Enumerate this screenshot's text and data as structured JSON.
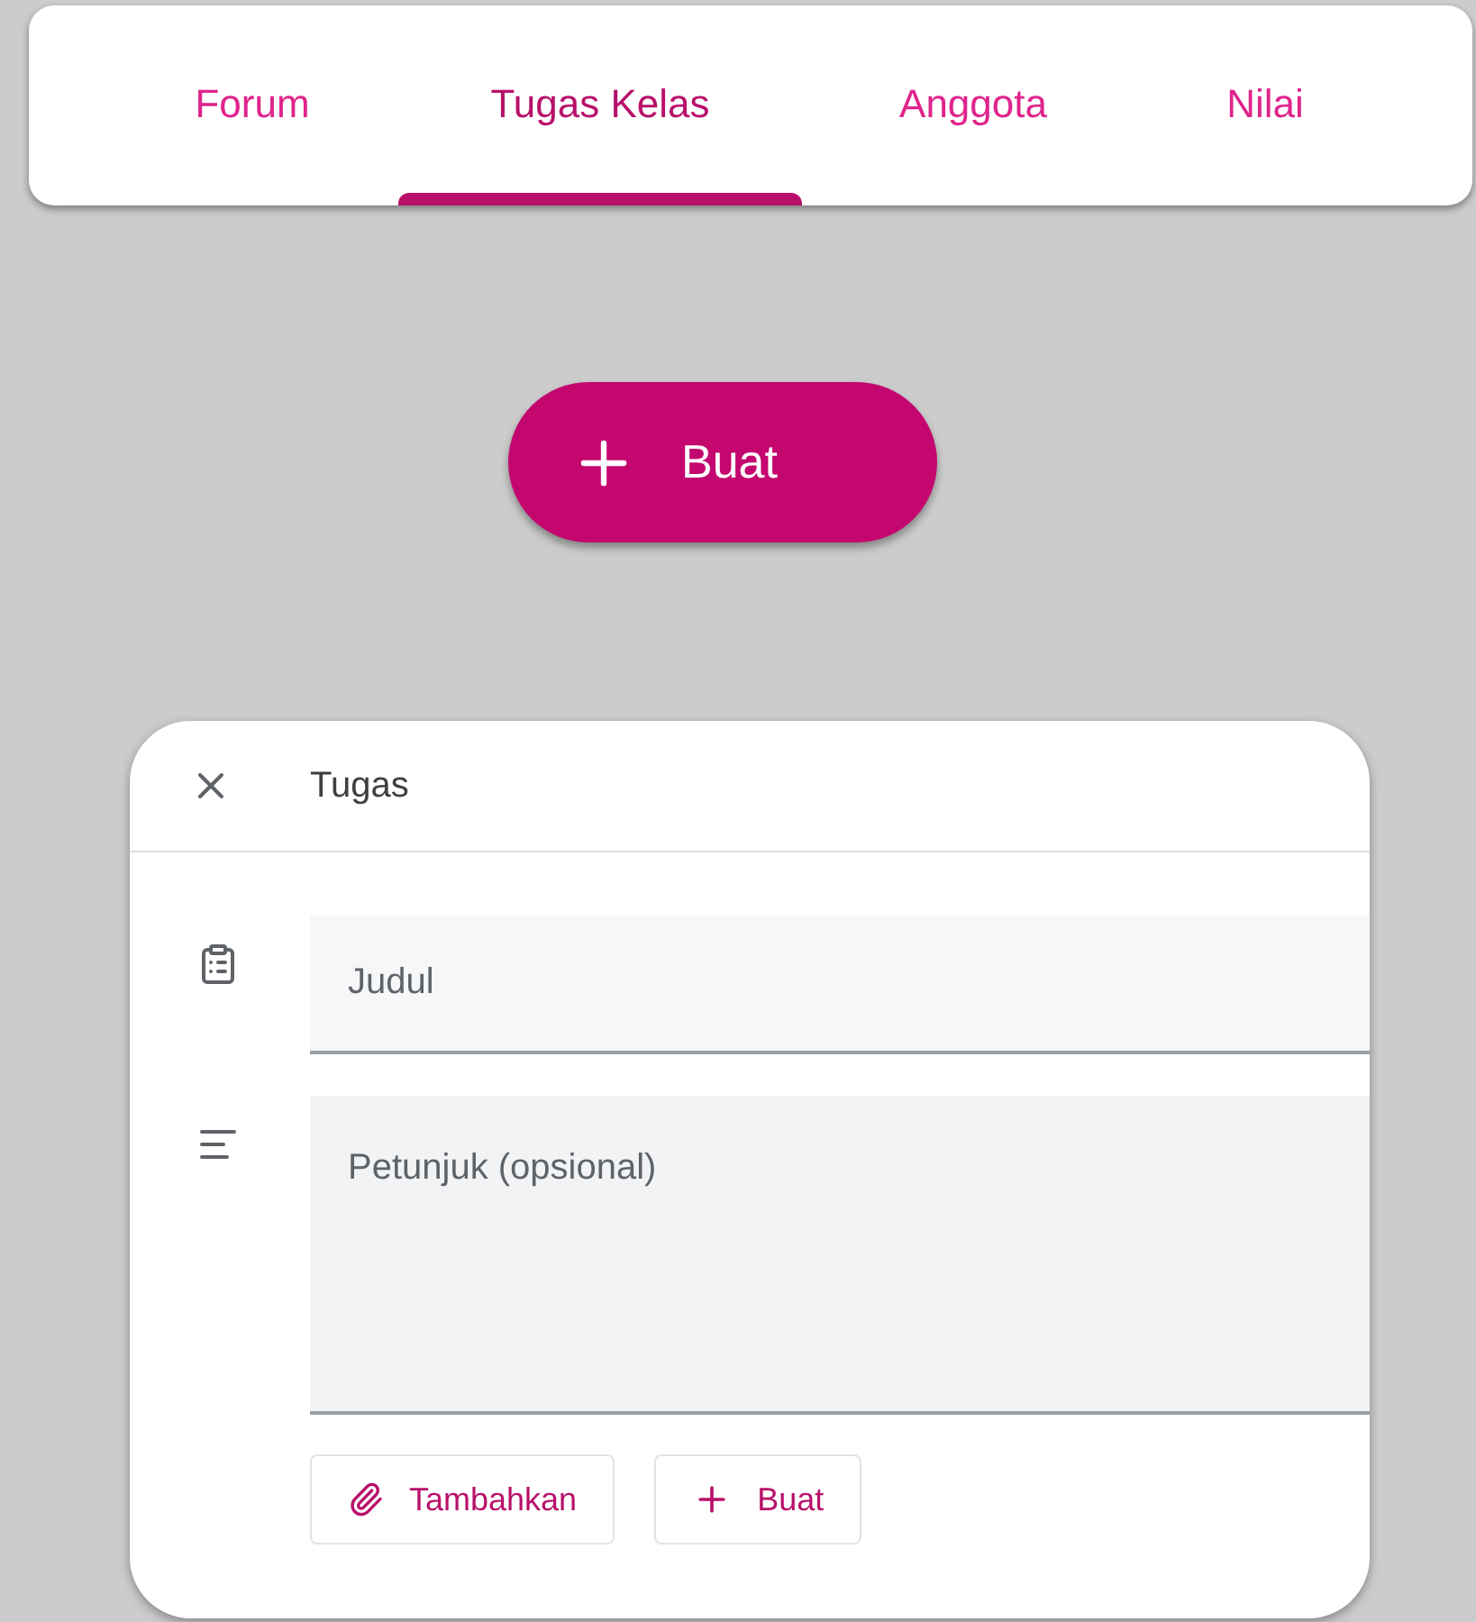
{
  "tabs": [
    {
      "label": "Forum",
      "selected": false
    },
    {
      "label": "Tugas Kelas",
      "selected": true
    },
    {
      "label": "Anggota",
      "selected": false
    },
    {
      "label": "Nilai",
      "selected": false
    }
  ],
  "create_button": {
    "label": "Buat"
  },
  "dialog": {
    "title": "Tugas",
    "title_field": {
      "placeholder": "Judul"
    },
    "instructions_field": {
      "placeholder": "Petunjuk (opsional)"
    },
    "actions": [
      {
        "kind": "attach",
        "label": "Tambahkan"
      },
      {
        "kind": "create",
        "label": "Buat"
      }
    ]
  }
}
